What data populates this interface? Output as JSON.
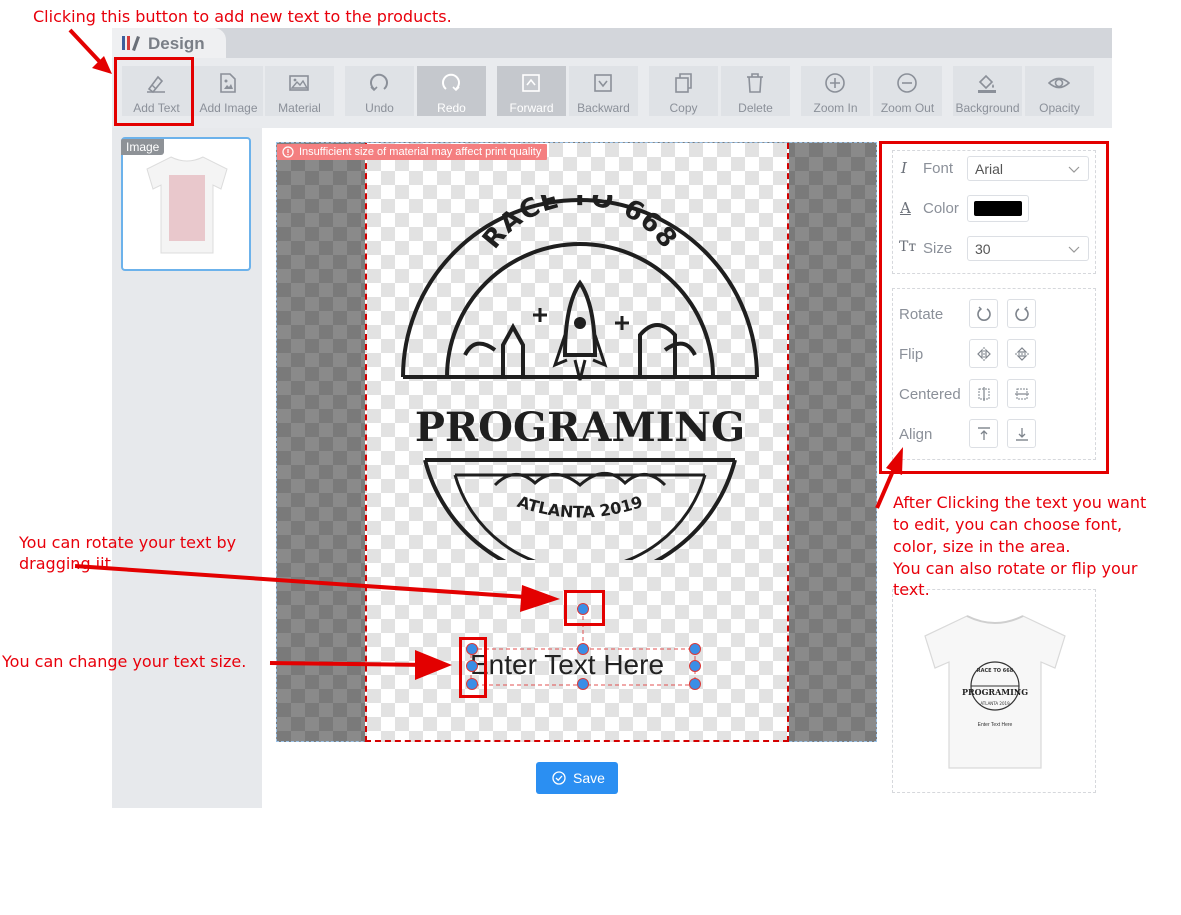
{
  "app": {
    "tab_title": "Design"
  },
  "toolbar": [
    {
      "label": "Add Text",
      "icon": "add-text-icon"
    },
    {
      "label": "Add Image",
      "icon": "add-image-icon"
    },
    {
      "label": "Material",
      "icon": "material-icon"
    },
    {
      "label": "Undo",
      "icon": "undo-icon"
    },
    {
      "label": "Redo",
      "icon": "redo-icon"
    },
    {
      "label": "Forward",
      "icon": "forward-icon"
    },
    {
      "label": "Backward",
      "icon": "backward-icon"
    },
    {
      "label": "Copy",
      "icon": "copy-icon"
    },
    {
      "label": "Delete",
      "icon": "delete-icon"
    },
    {
      "label": "Zoom In",
      "icon": "zoom-in-icon"
    },
    {
      "label": "Zoom Out",
      "icon": "zoom-out-icon"
    },
    {
      "label": "Background",
      "icon": "background-icon"
    },
    {
      "label": "Opacity",
      "icon": "opacity-icon"
    }
  ],
  "sidebar": {
    "thumbnail_badge": "Image"
  },
  "canvas": {
    "warning": "Insufficient size of material may affect print quality",
    "design": {
      "top_arc": "RACE TO 668",
      "main_word": "PROGRAMING",
      "bottom_arc": "ATLANTA 2019"
    },
    "text_object": "Enter Text Here"
  },
  "save_button": {
    "label": "Save"
  },
  "properties": {
    "font_label": "Font",
    "font_value": "Arial",
    "color_label": "Color",
    "color_value": "#000000",
    "size_label": "Size",
    "size_value": "30",
    "rotate_label": "Rotate",
    "flip_label": "Flip",
    "centered_label": "Centered",
    "align_label": "Align"
  },
  "preview": {
    "top_arc": "RACE TO 668",
    "main_word": "PROGRAMING",
    "bottom_arc": "ATLANTA 2019",
    "text": "Enter Text Here"
  },
  "annotations": {
    "top": "Clicking this button to add new text to the products.",
    "rotate_line1": "You can rotate your text by",
    "rotate_line2": "dragging iit",
    "size": "You can change your text size.",
    "panel_line1": "After Clicking the text you want",
    "panel_line2": "to edit, you can choose font,",
    "panel_line3": "color, size in the area.",
    "panel_line4": "You can also rotate or flip your",
    "panel_line5": "text."
  },
  "colors": {
    "accent": "#2b8ff2",
    "annotation": "#e8000b",
    "warning": "#f47f80"
  }
}
